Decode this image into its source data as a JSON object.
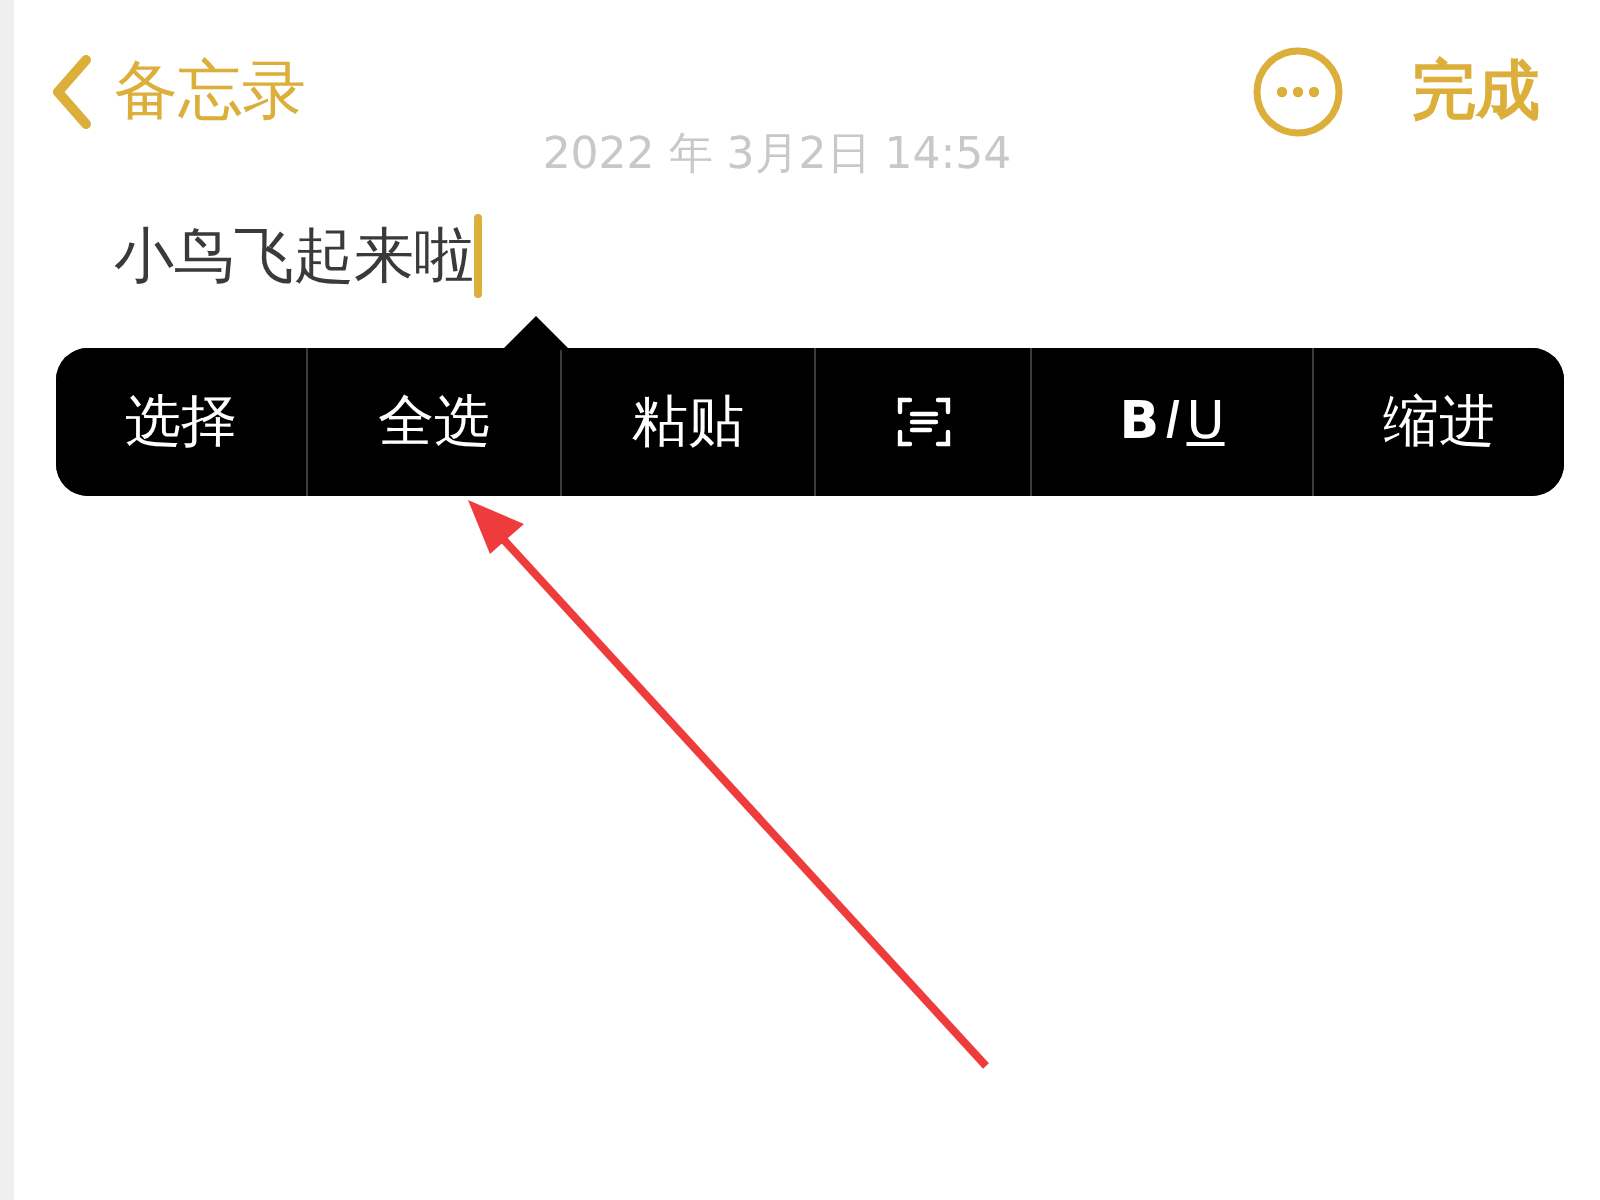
{
  "nav": {
    "back_label": "备忘录",
    "done_label": "完成"
  },
  "date": "2022 年 3月2日 14:54",
  "note": {
    "text": "小鸟飞起来啦"
  },
  "edit_menu": [
    {
      "kind": "text",
      "label": "选择"
    },
    {
      "kind": "text",
      "label": "全选"
    },
    {
      "kind": "text",
      "label": "粘贴"
    },
    {
      "kind": "icon"
    },
    {
      "kind": "format",
      "bold": "B",
      "italic": "I",
      "underline": "U"
    },
    {
      "kind": "text",
      "label": "缩进"
    }
  ]
}
